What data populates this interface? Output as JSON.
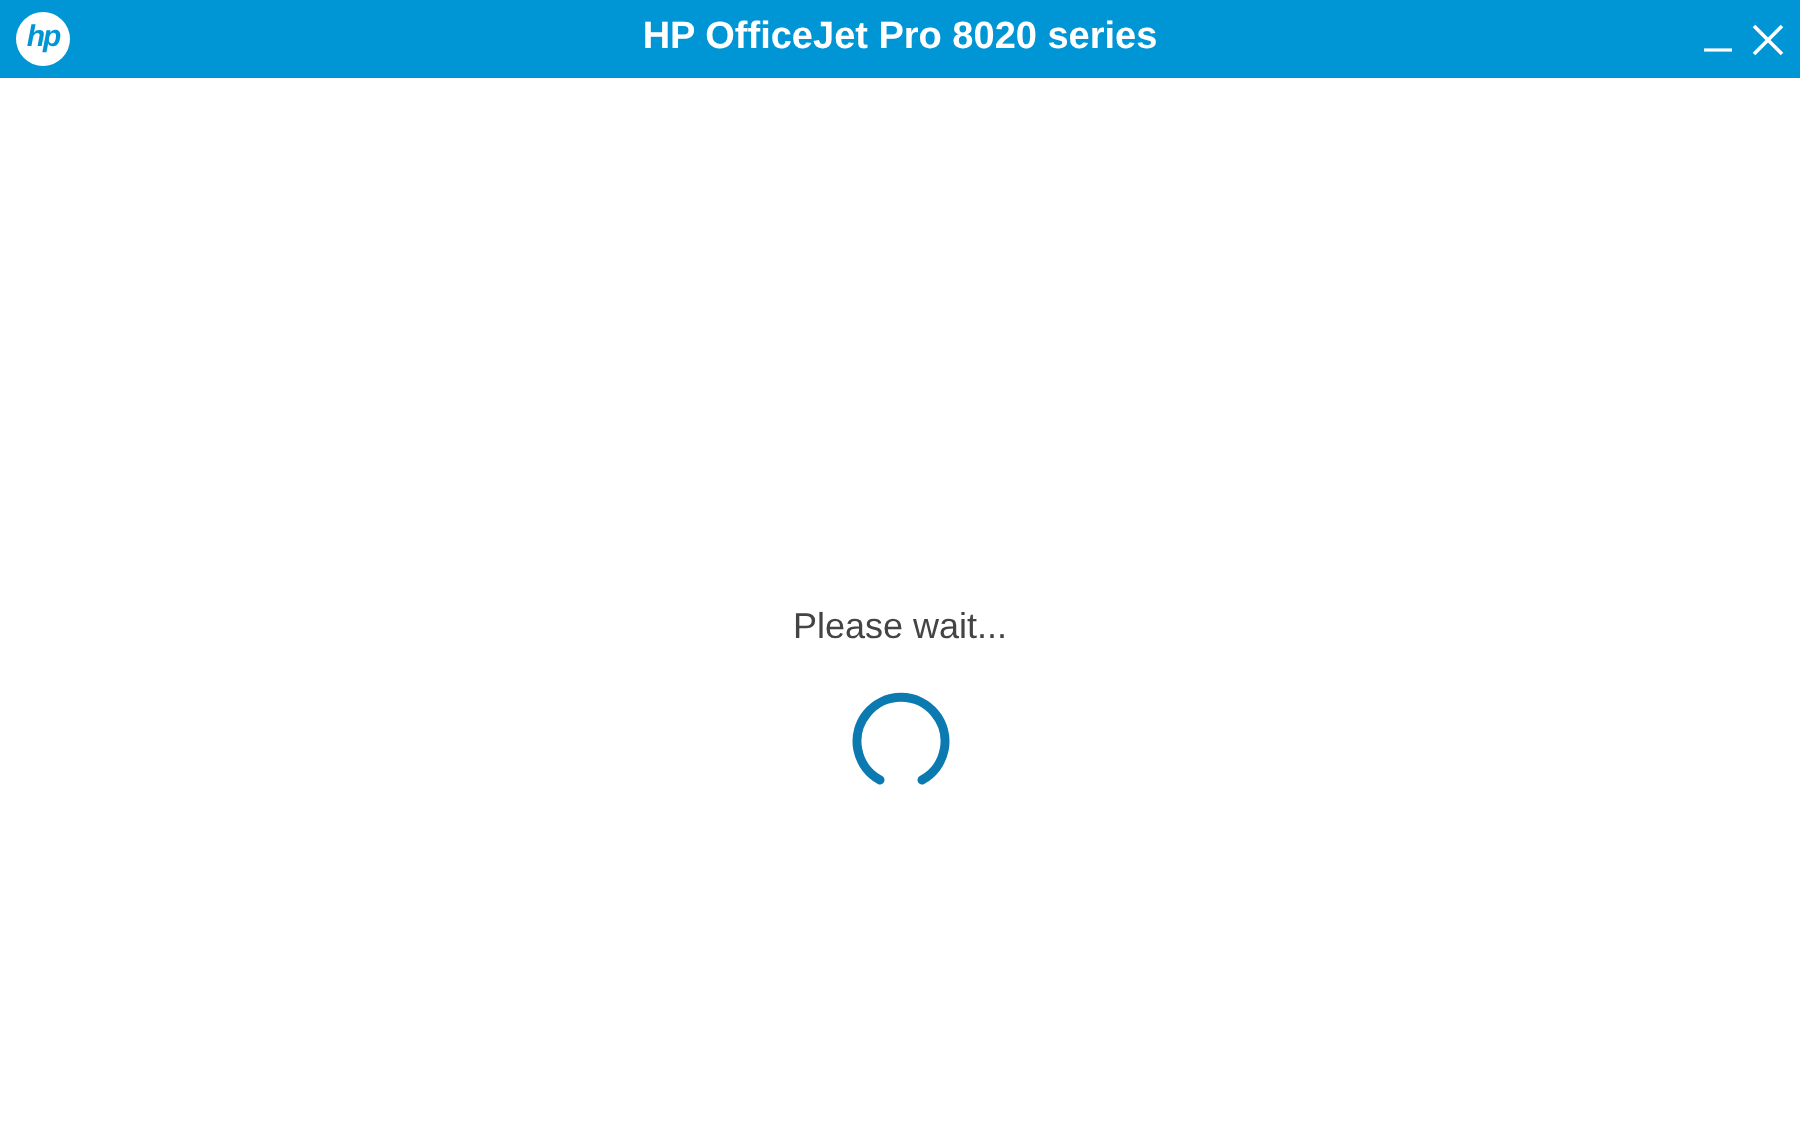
{
  "window": {
    "logo": "hp",
    "title": "HP OfficeJet Pro 8020 series"
  },
  "content": {
    "message": "Please wait..."
  }
}
